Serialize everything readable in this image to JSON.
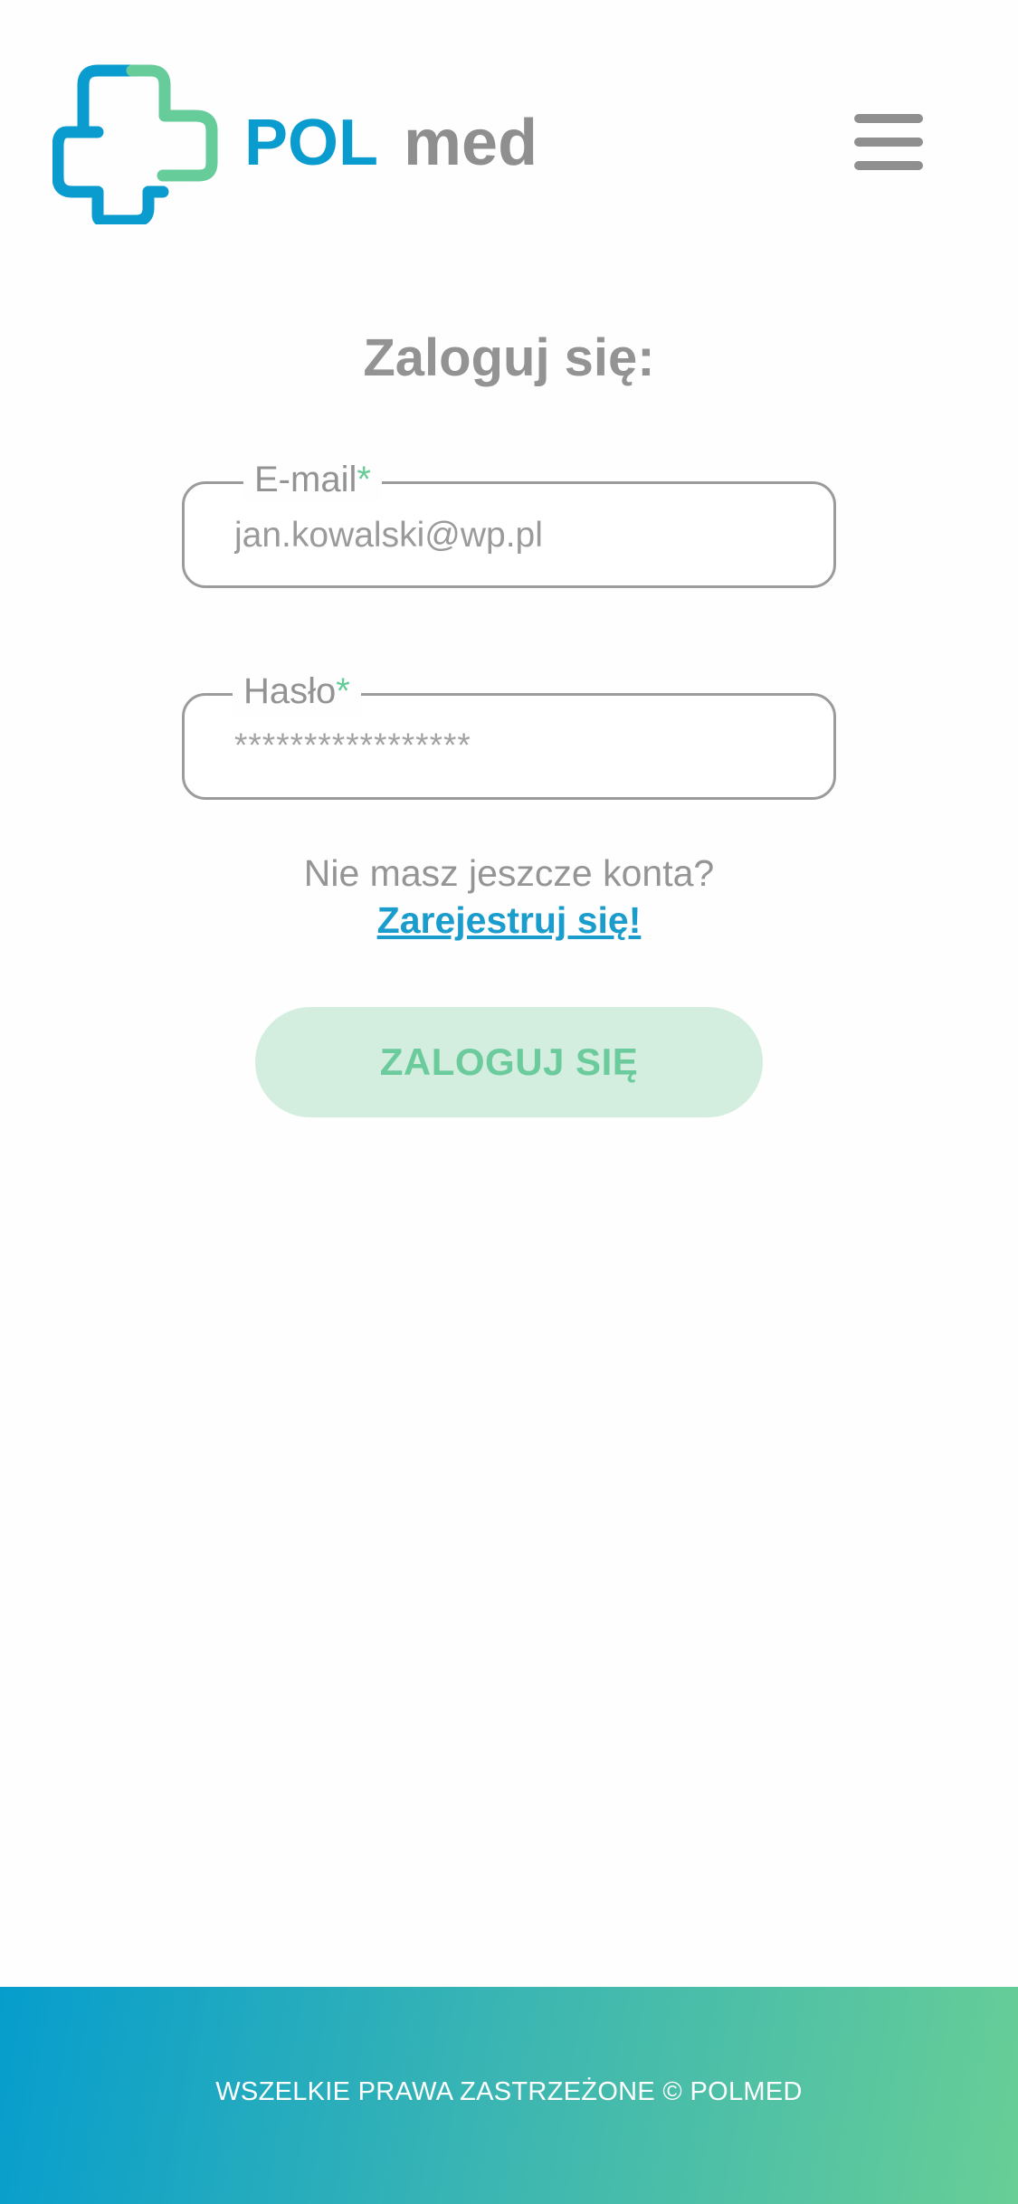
{
  "header": {
    "logo_text_primary": "POL",
    "logo_text_secondary": "med",
    "menu_icon": "hamburger-menu-icon"
  },
  "login": {
    "title": "Zaloguj się:",
    "email": {
      "label": "E-mail",
      "required_mark": "*",
      "value": "jan.kowalski@wp.pl"
    },
    "password": {
      "label": "Hasło",
      "required_mark": "*",
      "masked_value": "*****************"
    },
    "register_prompt": "Nie masz jeszcze konta?",
    "register_link": "Zarejestruj się!",
    "submit_label": "ZALOGUJ SIĘ"
  },
  "footer": {
    "copyright": "WSZELKIE PRAWA ZASTRZEŻONE © POLMED"
  },
  "colors": {
    "brand_blue": "#0a9ccf",
    "brand_green": "#66cc99",
    "text_gray": "#939393",
    "button_bg": "#d3eedf"
  }
}
